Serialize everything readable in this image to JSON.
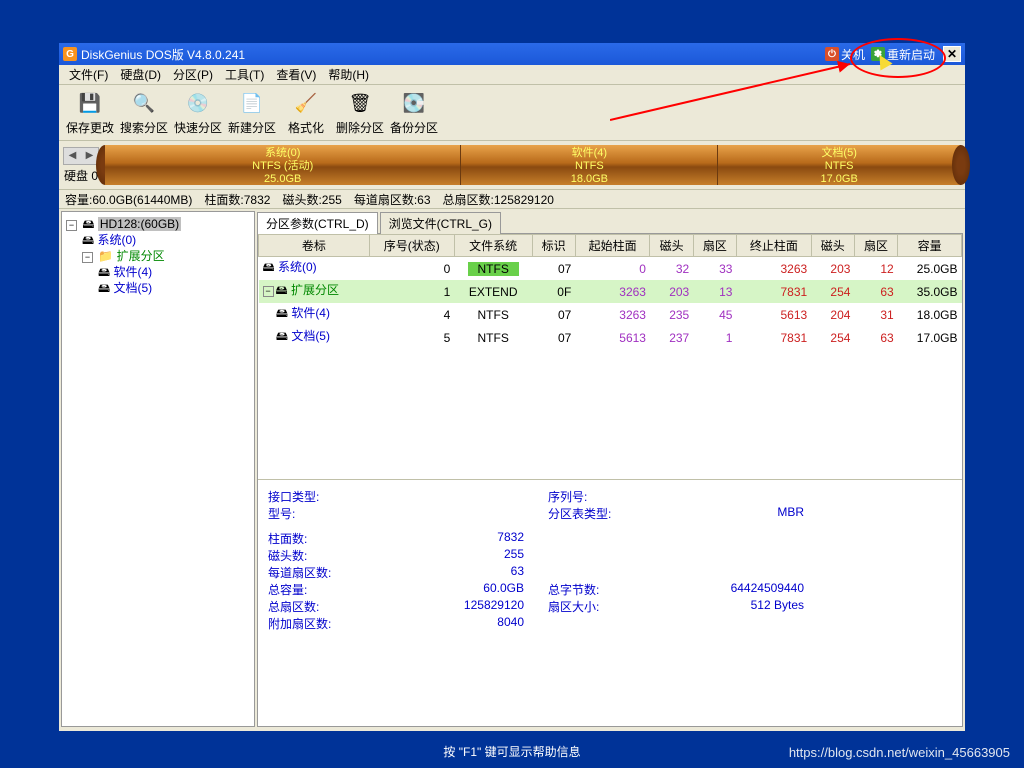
{
  "title": "DiskGenius DOS版 V4.8.0.241",
  "sys": {
    "shutdown": "关机",
    "restart": "重新启动"
  },
  "menu": [
    "文件(F)",
    "硬盘(D)",
    "分区(P)",
    "工具(T)",
    "查看(V)",
    "帮助(H)"
  ],
  "toolbar": [
    {
      "name": "save",
      "label": "保存更改",
      "icon": "💾"
    },
    {
      "name": "search",
      "label": "搜索分区",
      "icon": "🔍"
    },
    {
      "name": "quick",
      "label": "快速分区",
      "icon": "💿"
    },
    {
      "name": "new",
      "label": "新建分区",
      "icon": "📄"
    },
    {
      "name": "format",
      "label": "格式化",
      "icon": "🧹"
    },
    {
      "name": "delete",
      "label": "删除分区",
      "icon": "🗑"
    },
    {
      "name": "backup",
      "label": "备份分区",
      "icon": "💽"
    }
  ],
  "diskbar": {
    "navlabel": "硬盘 0",
    "parts": [
      {
        "title": "系统(0)",
        "fs": "NTFS (活动)",
        "size": "25.0GB",
        "flex": 25
      },
      {
        "title": "软件(4)",
        "fs": "NTFS",
        "size": "18.0GB",
        "flex": 18
      },
      {
        "title": "文档(5)",
        "fs": "NTFS",
        "size": "17.0GB",
        "flex": 17
      }
    ]
  },
  "infoline": {
    "cap_lbl": "容量:",
    "cap": "60.0GB(61440MB)",
    "cyl_lbl": "柱面数:",
    "cyl": "7832",
    "head_lbl": "磁头数:",
    "head": "255",
    "spt_lbl": "每道扇区数:",
    "spt": "63",
    "tot_lbl": "总扇区数:",
    "tot": "125829120"
  },
  "tree": {
    "root": "HD128:(60GB)",
    "items": [
      "系统(0)",
      "扩展分区",
      "软件(4)",
      "文档(5)"
    ]
  },
  "tabs": [
    "分区参数(CTRL_D)",
    "浏览文件(CTRL_G)"
  ],
  "cols": [
    "卷标",
    "序号(状态)",
    "文件系统",
    "标识",
    "起始柱面",
    "磁头",
    "扇区",
    "终止柱面",
    "磁头",
    "扇区",
    "容量"
  ],
  "rows": [
    {
      "name": "系统(0)",
      "idx": "0",
      "fs": "NTFS",
      "fs_badge": true,
      "id": "07",
      "sc": "0",
      "sh": "32",
      "ss": "33",
      "ec": "3263",
      "eh": "203",
      "es": "12",
      "cap": "25.0GB",
      "hl": false
    },
    {
      "name": "扩展分区",
      "idx": "1",
      "fs": "EXTEND",
      "fs_badge": false,
      "id": "0F",
      "sc": "3263",
      "sh": "203",
      "ss": "13",
      "ec": "7831",
      "eh": "254",
      "es": "63",
      "cap": "35.0GB",
      "hl": true,
      "exp": true
    },
    {
      "name": "软件(4)",
      "idx": "4",
      "fs": "NTFS",
      "fs_badge": false,
      "id": "07",
      "sc": "3263",
      "sh": "235",
      "ss": "45",
      "ec": "5613",
      "eh": "204",
      "es": "31",
      "cap": "18.0GB",
      "hl": false,
      "indent": true
    },
    {
      "name": "文档(5)",
      "idx": "5",
      "fs": "NTFS",
      "fs_badge": false,
      "id": "07",
      "sc": "5613",
      "sh": "237",
      "ss": "1",
      "ec": "7831",
      "eh": "254",
      "es": "63",
      "cap": "17.0GB",
      "hl": false,
      "indent": true
    }
  ],
  "detail": {
    "iface_lbl": "接口类型:",
    "iface": "",
    "serial_lbl": "序列号:",
    "serial": "",
    "model_lbl": "型号:",
    "model": "",
    "pttype_lbl": "分区表类型:",
    "pttype": "MBR",
    "cyl_lbl": "柱面数:",
    "cyl": "7832",
    "head_lbl": "磁头数:",
    "head": "255",
    "spt_lbl": "每道扇区数:",
    "spt": "63",
    "cap_lbl": "总容量:",
    "cap": "60.0GB",
    "bytes_lbl": "总字节数:",
    "bytes": "64424509440",
    "tot_lbl": "总扇区数:",
    "tot": "125829120",
    "secsz_lbl": "扇区大小:",
    "secsz": "512 Bytes",
    "app_lbl": "附加扇区数:",
    "app": "8040"
  },
  "status": "按 \"F1\" 键可显示帮助信息",
  "watermark": "https://blog.csdn.net/weixin_45663905"
}
